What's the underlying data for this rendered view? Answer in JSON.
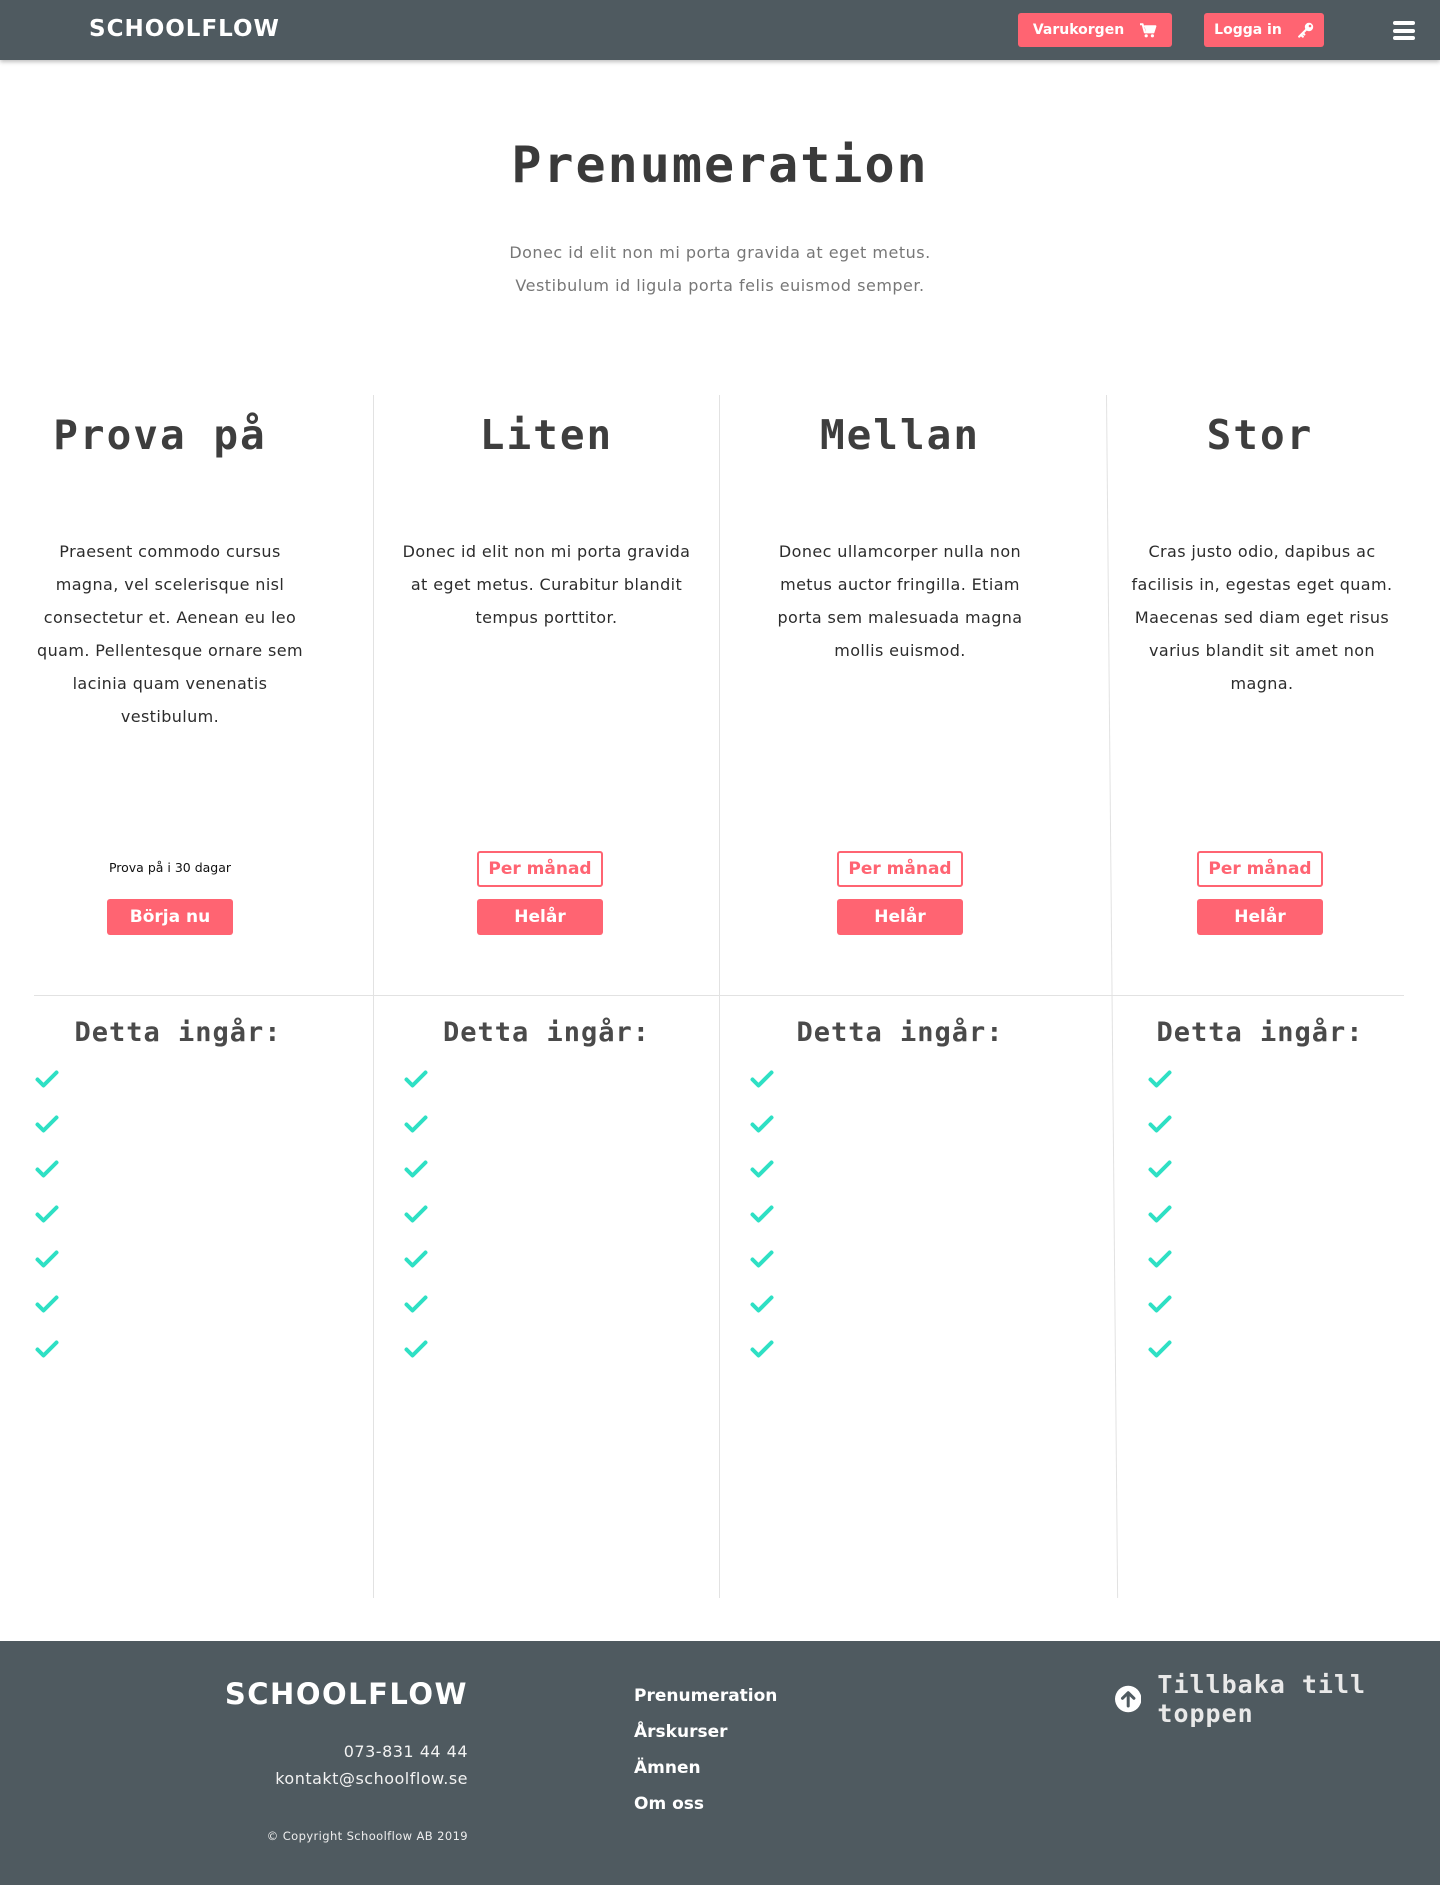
{
  "header": {
    "logo": "SCHOOLFLOW",
    "cart_label": "Varukorgen",
    "login_label": "Logga in"
  },
  "hero": {
    "title": "Prenumeration",
    "intro_line1": "Donec id elit non mi porta gravida at eget metus.",
    "intro_line2": "Vestibulum id ligula porta felis euismod semper."
  },
  "plans": [
    {
      "name": "Prova på",
      "description": "Praesent commodo cursus magna, vel scelerisque nisl consectetur et. Aenean eu leo quam. Pellentesque ornare sem lacinia quam venenatis vestibulum.",
      "trial_note": "Prova på i 30 dagar",
      "button": "Börja nu",
      "included_title": "Detta ingår:"
    },
    {
      "name": "Liten",
      "description": "Donec id elit non mi porta gravida at eget metus. Curabitur blandit tempus porttitor.",
      "monthly_label": "Per månad",
      "yearly_label": "Helår",
      "included_title": "Detta ingår:"
    },
    {
      "name": "Mellan",
      "description": "Donec ullamcorper nulla non metus auctor fringilla. Etiam porta sem malesuada magna mollis euismod.",
      "monthly_label": "Per månad",
      "yearly_label": "Helår",
      "included_title": "Detta ingår:"
    },
    {
      "name": "Stor",
      "description": "Cras justo odio, dapibus ac facilisis in, egestas eget quam. Maecenas sed diam eget risus varius blandit sit amet non magna.",
      "monthly_label": "Per månad",
      "yearly_label": "Helår",
      "included_title": "Detta ingår:"
    }
  ],
  "footer": {
    "logo": "SCHOOLFLOW",
    "phone": "073-831 44 44",
    "email": "kontakt@schoolflow.se",
    "copyright": "© Copyright Schoolflow AB 2019",
    "links": [
      "Prenumeration",
      "Årskurser",
      "Ämnen",
      "Om oss"
    ],
    "back_to_top": "Tillbaka till toppen"
  },
  "colors": {
    "header_bg": "#4f5a60",
    "accent": "#ff6472",
    "check": "#2ee0c4",
    "divider": "#e2e2e2"
  },
  "icons": {
    "cart": "cart-icon",
    "login": "key-icon",
    "menu": "hamburger-menu-icon",
    "included": "check-icon",
    "back_to_top": "arrow-up-circle-icon"
  }
}
